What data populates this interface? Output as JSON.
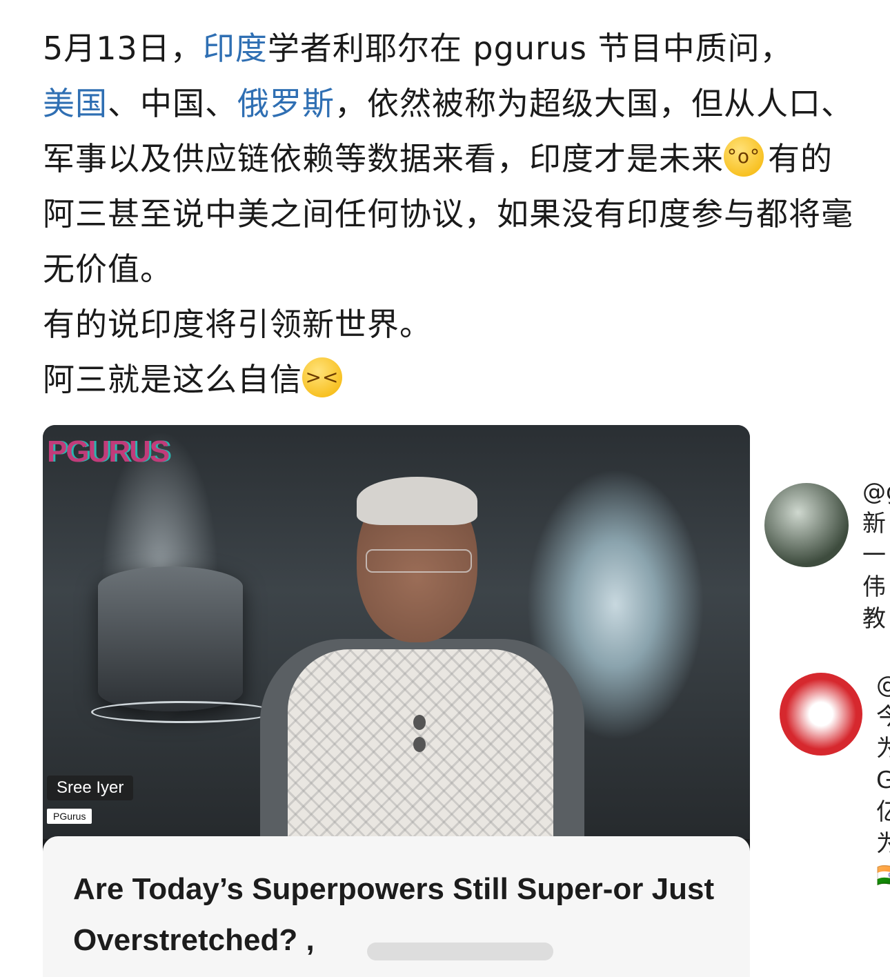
{
  "post": {
    "p1_a": "5月13日，",
    "link_india": "印度",
    "p1_b": "学者利耶尔在 pgurus 节目中质问，",
    "link_us": "美国",
    "p1_c": "、中国、",
    "link_russia": "俄罗斯",
    "p1_d": "，依然被称为超级大国，但从人口、军事以及供应链依赖等数据来看，印度才是未来",
    "emoji1": "flushed-face-emoji",
    "p1_e": "有的阿三甚至说中美之间任何协议，如果没有印度参与都将毫无价值。",
    "p2": "有的说印度将引领新世界。",
    "p3": "阿三就是这么自信",
    "emoji2": "grinning-squinting-face-emoji"
  },
  "video": {
    "logo": "PGURUS",
    "speaker_name": "Sree Iyer",
    "channel": "PGurus",
    "title": "Are Today’s Superpowers Still Super-or Just Overstretched? ,"
  },
  "side_comments": [
    {
      "lines": [
        "@g",
        "新",
        "一",
        "伟",
        "教"
      ]
    },
    {
      "lines": [
        "@",
        "今",
        "为",
        "G",
        "亿",
        "",
        "为",
        "🇮🇳"
      ]
    }
  ],
  "colors": {
    "link": "#2f6fb3",
    "text": "#1a1a1a"
  }
}
